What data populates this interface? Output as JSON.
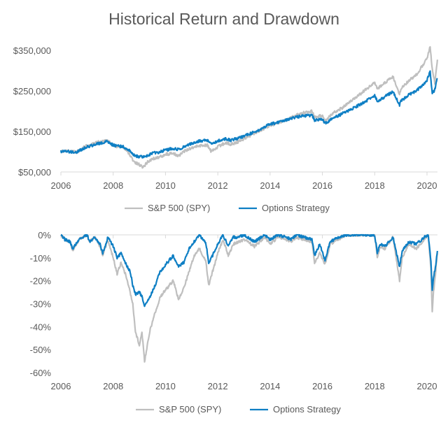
{
  "title": "Historical Return and Drawdown",
  "colors": {
    "spy": "#BFBFBF",
    "options": "#0F7FC4",
    "axis": "#D9D9D9",
    "text": "#595959"
  },
  "chart_data": [
    {
      "type": "line",
      "name": "historical-return",
      "title": "Historical Return and Drawdown",
      "xlabel": "",
      "ylabel": "",
      "xlim": [
        2006,
        2020.4
      ],
      "ylim": [
        50000,
        350000
      ],
      "x_ticks": [
        2006,
        2008,
        2010,
        2012,
        2014,
        2016,
        2018,
        2020
      ],
      "x_tick_labels": [
        "2006",
        "2008",
        "2010",
        "2012",
        "2014",
        "2016",
        "2018",
        "2020"
      ],
      "y_ticks": [
        50000,
        150000,
        250000,
        350000
      ],
      "y_tick_labels": [
        "$50,000",
        "$150,000",
        "$250,000",
        "$350,000"
      ],
      "grid": false,
      "legend": "bottom",
      "legend_labels": [
        "S&P 500 (SPY)",
        "Options Strategy"
      ],
      "x": [
        2006,
        2006.25,
        2006.4,
        2006.6,
        2006.8,
        2007,
        2007.2,
        2007.4,
        2007.6,
        2007.8,
        2008,
        2008.2,
        2008.4,
        2008.6,
        2008.75,
        2008.85,
        2009,
        2009.15,
        2009.3,
        2009.5,
        2009.75,
        2010,
        2010.3,
        2010.5,
        2010.75,
        2011,
        2011.3,
        2011.6,
        2011.75,
        2012,
        2012.3,
        2012.5,
        2012.8,
        2013,
        2013.3,
        2013.6,
        2014,
        2014.3,
        2014.6,
        2015,
        2015.3,
        2015.6,
        2015.7,
        2016,
        2016.1,
        2016.4,
        2016.8,
        2017,
        2017.5,
        2018,
        2018.1,
        2018.3,
        2018.7,
        2018.95,
        2019,
        2019.3,
        2019.6,
        2020,
        2020.12,
        2020.2,
        2020.3,
        2020.4
      ],
      "series": [
        {
          "name": "S&P 500 (SPY)",
          "values": [
            100000,
            102000,
            100000,
            99000,
            108000,
            115000,
            118000,
            124000,
            126000,
            128000,
            114000,
            113000,
            110000,
            96000,
            80000,
            72000,
            68000,
            62000,
            74000,
            82000,
            86000,
            94000,
            95000,
            90000,
            102000,
            110000,
            115000,
            116000,
            100000,
            112000,
            122000,
            118000,
            125000,
            132000,
            142000,
            152000,
            165000,
            170000,
            178000,
            190000,
            196000,
            200000,
            185000,
            190000,
            176000,
            195000,
            210000,
            220000,
            245000,
            270000,
            255000,
            265000,
            285000,
            240000,
            255000,
            275000,
            290000,
            330000,
            360000,
            305000,
            270000,
            327000
          ]
        },
        {
          "name": "Options Strategy",
          "values": [
            100000,
            101000,
            99000,
            99000,
            105000,
            112000,
            115000,
            120000,
            122000,
            125000,
            116000,
            114000,
            112000,
            104000,
            95000,
            90000,
            88000,
            86000,
            90000,
            96000,
            99000,
            104000,
            108000,
            106000,
            114000,
            120000,
            126000,
            128000,
            118000,
            126000,
            132000,
            128000,
            134000,
            138000,
            146000,
            155000,
            168000,
            172000,
            178000,
            186000,
            188000,
            190000,
            178000,
            180000,
            170000,
            182000,
            195000,
            202000,
            218000,
            238000,
            225000,
            232000,
            248000,
            215000,
            225000,
            240000,
            250000,
            275000,
            300000,
            240000,
            255000,
            281000
          ]
        }
      ]
    },
    {
      "type": "line",
      "name": "drawdown",
      "title": "",
      "xlabel": "",
      "ylabel": "",
      "xlim": [
        2006,
        2020.4
      ],
      "ylim": [
        -0.6,
        0
      ],
      "x_ticks": [
        2006,
        2008,
        2010,
        2012,
        2014,
        2016,
        2018,
        2020
      ],
      "x_tick_labels": [
        "2006",
        "2008",
        "2010",
        "2012",
        "2014",
        "2016",
        "2018",
        "2020"
      ],
      "y_ticks": [
        0,
        -0.1,
        -0.2,
        -0.3,
        -0.4,
        -0.5,
        -0.6
      ],
      "y_tick_labels": [
        "0%",
        "-10%",
        "-20%",
        "-30%",
        "-40%",
        "-50%",
        "-60%"
      ],
      "grid": false,
      "legend": "bottom",
      "legend_labels": [
        "S&P 500 (SPY)",
        "Options Strategy"
      ],
      "x": [
        2006,
        2006.15,
        2006.35,
        2006.45,
        2006.7,
        2007,
        2007.1,
        2007.3,
        2007.5,
        2007.6,
        2007.8,
        2008,
        2008.15,
        2008.3,
        2008.5,
        2008.65,
        2008.75,
        2008.85,
        2009,
        2009.1,
        2009.2,
        2009.4,
        2009.6,
        2009.8,
        2010,
        2010.3,
        2010.5,
        2010.7,
        2010.9,
        2011.1,
        2011.3,
        2011.55,
        2011.65,
        2011.8,
        2012,
        2012.2,
        2012.4,
        2012.6,
        2012.8,
        2013,
        2013.4,
        2013.8,
        2014,
        2014.3,
        2014.6,
        2014.8,
        2015,
        2015.3,
        2015.6,
        2015.7,
        2015.9,
        2016.1,
        2016.3,
        2016.6,
        2016.9,
        2017.2,
        2017.6,
        2018,
        2018.1,
        2018.2,
        2018.4,
        2018.7,
        2018.95,
        2019.05,
        2019.3,
        2019.6,
        2019.9,
        2020.05,
        2020.15,
        2020.2,
        2020.25,
        2020.32,
        2020.4
      ],
      "series": [
        {
          "name": "S&P 500 (SPY)",
          "values": [
            0,
            -0.02,
            -0.03,
            -0.07,
            -0.02,
            0,
            -0.03,
            -0.01,
            -0.05,
            -0.09,
            -0.02,
            -0.1,
            -0.17,
            -0.12,
            -0.18,
            -0.25,
            -0.3,
            -0.42,
            -0.48,
            -0.43,
            -0.55,
            -0.42,
            -0.34,
            -0.27,
            -0.24,
            -0.2,
            -0.28,
            -0.23,
            -0.16,
            -0.09,
            -0.06,
            -0.12,
            -0.22,
            -0.16,
            -0.08,
            -0.02,
            -0.09,
            -0.04,
            -0.03,
            -0.02,
            -0.05,
            -0.01,
            -0.04,
            -0.01,
            -0.02,
            -0.03,
            -0.01,
            -0.02,
            -0.03,
            -0.12,
            -0.08,
            -0.13,
            -0.04,
            -0.02,
            0,
            0,
            0,
            0,
            -0.1,
            -0.05,
            -0.06,
            -0.01,
            -0.2,
            -0.1,
            -0.04,
            -0.06,
            -0.02,
            0,
            -0.15,
            -0.34,
            -0.25,
            -0.17,
            -0.08
          ]
        },
        {
          "name": "Options Strategy",
          "values": [
            0,
            -0.02,
            -0.03,
            -0.06,
            -0.02,
            0,
            -0.03,
            -0.01,
            -0.04,
            -0.08,
            -0.01,
            -0.05,
            -0.1,
            -0.08,
            -0.13,
            -0.16,
            -0.22,
            -0.26,
            -0.25,
            -0.27,
            -0.31,
            -0.27,
            -0.22,
            -0.16,
            -0.13,
            -0.09,
            -0.14,
            -0.12,
            -0.06,
            -0.03,
            0,
            -0.04,
            -0.12,
            -0.09,
            -0.04,
            0,
            -0.05,
            -0.01,
            -0.01,
            0,
            -0.03,
            0,
            -0.02,
            0,
            -0.01,
            -0.02,
            0,
            -0.01,
            -0.02,
            -0.09,
            -0.04,
            -0.11,
            -0.03,
            -0.01,
            0,
            0,
            0,
            0,
            -0.08,
            -0.04,
            -0.05,
            -0.01,
            -0.14,
            -0.07,
            -0.03,
            -0.04,
            -0.01,
            0,
            -0.12,
            -0.24,
            -0.19,
            -0.14,
            -0.07
          ]
        }
      ]
    }
  ]
}
